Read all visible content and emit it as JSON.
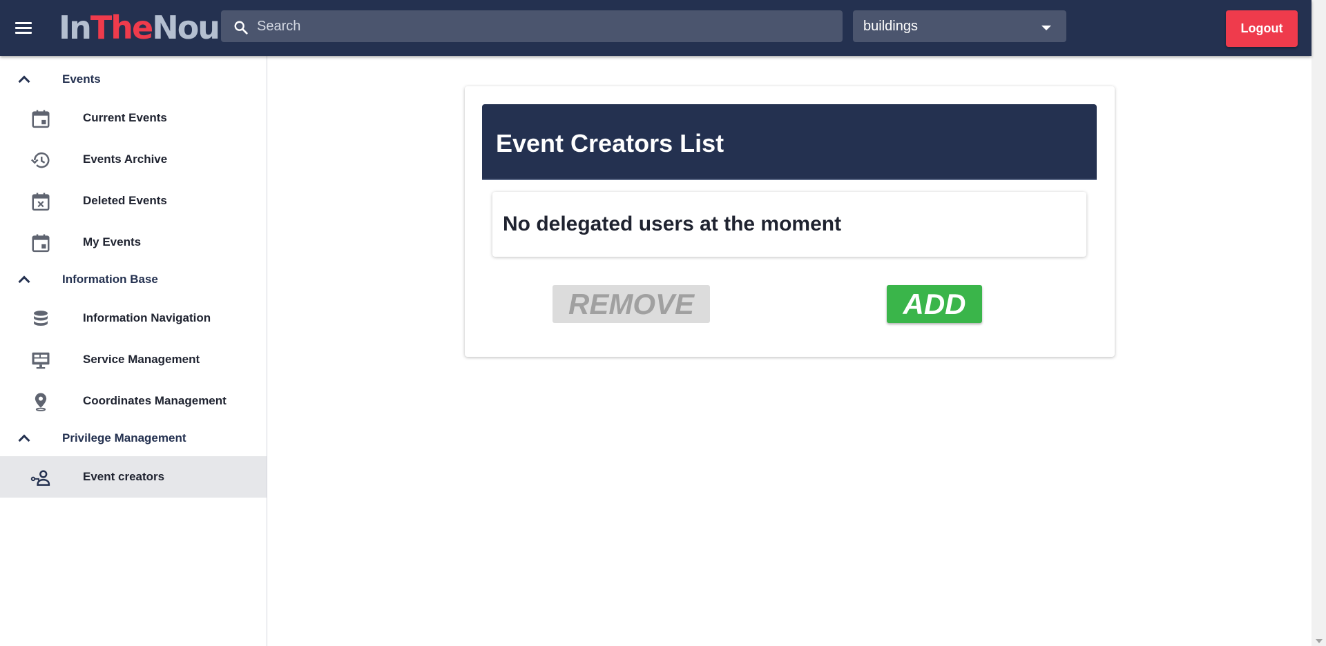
{
  "header": {
    "logo_part1": "In",
    "logo_part2": "The",
    "logo_part3": "Nou",
    "search_placeholder": "Search",
    "select_value": "buildings",
    "logout_label": "Logout"
  },
  "sidebar": {
    "groups": [
      {
        "label": "Events",
        "items": [
          {
            "label": "Current Events",
            "icon": "calendar-icon"
          },
          {
            "label": "Events Archive",
            "icon": "history-icon"
          },
          {
            "label": "Deleted Events",
            "icon": "calendar-x-icon"
          },
          {
            "label": "My Events",
            "icon": "calendar-icon"
          }
        ]
      },
      {
        "label": "Information Base",
        "items": [
          {
            "label": "Information Navigation",
            "icon": "database-icon"
          },
          {
            "label": "Service Management",
            "icon": "monitor-icon"
          },
          {
            "label": "Coordinates Management",
            "icon": "location-pin-icon"
          }
        ]
      },
      {
        "label": "Privilege Management",
        "items": [
          {
            "label": "Event creators",
            "icon": "user-key-icon",
            "active": true
          }
        ]
      }
    ]
  },
  "main": {
    "card_title": "Event Creators List",
    "empty_message": "No delegated users at the moment",
    "remove_label": "REMOVE",
    "add_label": "ADD"
  },
  "colors": {
    "navy": "#243150",
    "logo_accent": "#ef3b4c",
    "logout": "#ef3b4c",
    "add_button": "#3ab54a",
    "remove_disabled": "#dcdcdc"
  }
}
